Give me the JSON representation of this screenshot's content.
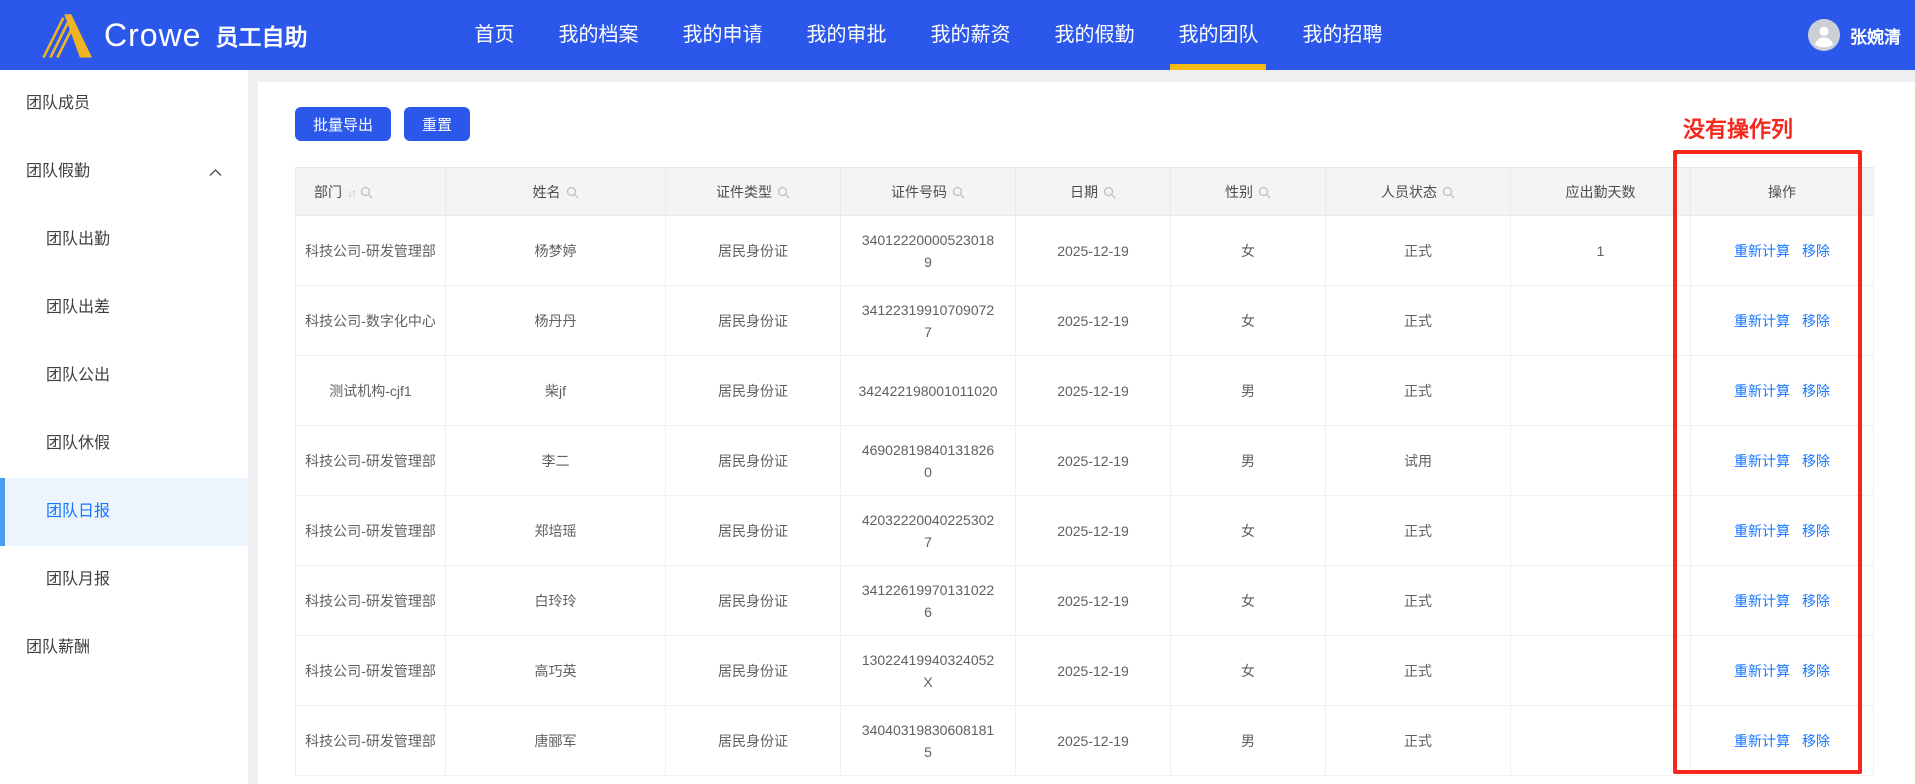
{
  "brand": {
    "name": "Crowe",
    "app": "员工自助",
    "logo_color": "#f0b323"
  },
  "nav": {
    "items": [
      {
        "label": "首页",
        "active": false
      },
      {
        "label": "我的档案",
        "active": false
      },
      {
        "label": "我的申请",
        "active": false
      },
      {
        "label": "我的审批",
        "active": false
      },
      {
        "label": "我的薪资",
        "active": false
      },
      {
        "label": "我的假勤",
        "active": false
      },
      {
        "label": "我的团队",
        "active": true
      },
      {
        "label": "我的招聘",
        "active": false
      }
    ],
    "user": "张婉清",
    "active_underline_color": "#f2ba13",
    "header_color": "#2b58ea"
  },
  "sidebar": {
    "items": [
      {
        "label": "团队成员",
        "level": 1,
        "active": false,
        "expanded": false
      },
      {
        "label": "团队假勤",
        "level": 1,
        "active": false,
        "expanded": true
      },
      {
        "label": "团队出勤",
        "level": 2,
        "active": false,
        "expanded": false
      },
      {
        "label": "团队出差",
        "level": 2,
        "active": false,
        "expanded": false
      },
      {
        "label": "团队公出",
        "level": 2,
        "active": false,
        "expanded": false
      },
      {
        "label": "团队休假",
        "level": 2,
        "active": false,
        "expanded": false
      },
      {
        "label": "团队日报",
        "level": 2,
        "active": true,
        "expanded": false
      },
      {
        "label": "团队月报",
        "level": 2,
        "active": false,
        "expanded": false
      },
      {
        "label": "团队薪酬",
        "level": 1,
        "active": false,
        "expanded": false
      }
    ],
    "active_color": "#1677ff"
  },
  "toolbar": {
    "export_label": "批量导出",
    "reset_label": "重置"
  },
  "annotation": {
    "text": "没有操作列",
    "color": "#f5281d"
  },
  "table": {
    "columns": [
      {
        "label": "部门",
        "sort": true,
        "search": true
      },
      {
        "label": "姓名",
        "sort": false,
        "search": true
      },
      {
        "label": "证件类型",
        "sort": false,
        "search": true
      },
      {
        "label": "证件号码",
        "sort": false,
        "search": true
      },
      {
        "label": "日期",
        "sort": false,
        "search": true
      },
      {
        "label": "性别",
        "sort": false,
        "search": true
      },
      {
        "label": "人员状态",
        "sort": false,
        "search": true
      },
      {
        "label": "应出勤天数",
        "sort": false,
        "search": false
      },
      {
        "label": "操作",
        "sort": false,
        "search": false
      }
    ],
    "actions": [
      "重新计算",
      "移除"
    ],
    "rows": [
      {
        "dept": "科技公司-研发管理部",
        "name": "杨梦婷",
        "id_type": "居民身份证",
        "id_no": "340122200005230189",
        "date": "2025-12-19",
        "gender": "女",
        "status": "正式",
        "days": "1"
      },
      {
        "dept": "科技公司-数字化中心",
        "name": "杨丹丹",
        "id_type": "居民身份证",
        "id_no": "341223199107090727",
        "date": "2025-12-19",
        "gender": "女",
        "status": "正式",
        "days": ""
      },
      {
        "dept": "测试机构-cjf1",
        "name": "柴jf",
        "id_type": "居民身份证",
        "id_no": "342422198001011020",
        "date": "2025-12-19",
        "gender": "男",
        "status": "正式",
        "days": ""
      },
      {
        "dept": "科技公司-研发管理部",
        "name": "李二",
        "id_type": "居民身份证",
        "id_no": "469028198401318260",
        "date": "2025-12-19",
        "gender": "男",
        "status": "试用",
        "days": ""
      },
      {
        "dept": "科技公司-研发管理部",
        "name": "郑培瑶",
        "id_type": "居民身份证",
        "id_no": "420322200402253027",
        "date": "2025-12-19",
        "gender": "女",
        "status": "正式",
        "days": ""
      },
      {
        "dept": "科技公司-研发管理部",
        "name": "白玲玲",
        "id_type": "居民身份证",
        "id_no": "341226199701310226",
        "date": "2025-12-19",
        "gender": "女",
        "status": "正式",
        "days": ""
      },
      {
        "dept": "科技公司-研发管理部",
        "name": "高巧英",
        "id_type": "居民身份证",
        "id_no": "13022419940324052X",
        "date": "2025-12-19",
        "gender": "女",
        "status": "正式",
        "days": ""
      },
      {
        "dept": "科技公司-研发管理部",
        "name": "唐郦军",
        "id_type": "居民身份证",
        "id_no": "340403198306081815",
        "date": "2025-12-19",
        "gender": "男",
        "status": "正式",
        "days": ""
      }
    ]
  }
}
